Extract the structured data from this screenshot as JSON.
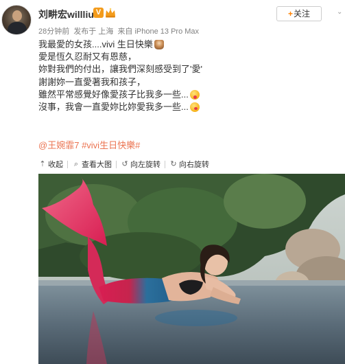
{
  "author": {
    "name": "刘畊宏willliu",
    "vip_badge": "V",
    "avatar_icon": "user-avatar",
    "level_icon": "crown-level-icon"
  },
  "follow": {
    "plus": "+",
    "label": "关注"
  },
  "meta": {
    "time": "28分钟前",
    "location": "发布于 上海",
    "source": "来自 iPhone 13 Pro Max"
  },
  "post": {
    "lines": [
      "我最愛的女孩....vivi 生日快樂",
      "愛是恆久忍耐又有恩慈，",
      "妳對我們的付出，讓我們深刻感受到了'愛'",
      "謝謝妳一直愛著我和孩子，",
      "雖然平常感覺好像愛孩子比我多一些...",
      "沒事，我會一直愛妳比妳愛我多一些..."
    ],
    "emojis": [
      "cake",
      "tongue-out",
      "kiss"
    ],
    "mention": "@王婉霏7",
    "hashtag": "#vivi生日快樂#"
  },
  "image_actions": [
    {
      "icon": "collapse-up-icon",
      "glyph": "⇡",
      "label": "收起"
    },
    {
      "icon": "magnifier-icon",
      "glyph": "⌕",
      "label": "查看大图"
    },
    {
      "icon": "rotate-left-icon",
      "glyph": "↺",
      "label": "向左旋转"
    },
    {
      "icon": "rotate-right-icon",
      "glyph": "↻",
      "label": "向右旋转"
    }
  ],
  "colors": {
    "link": "#eb7350",
    "accent": "#ff8200",
    "meta": "#808080"
  }
}
